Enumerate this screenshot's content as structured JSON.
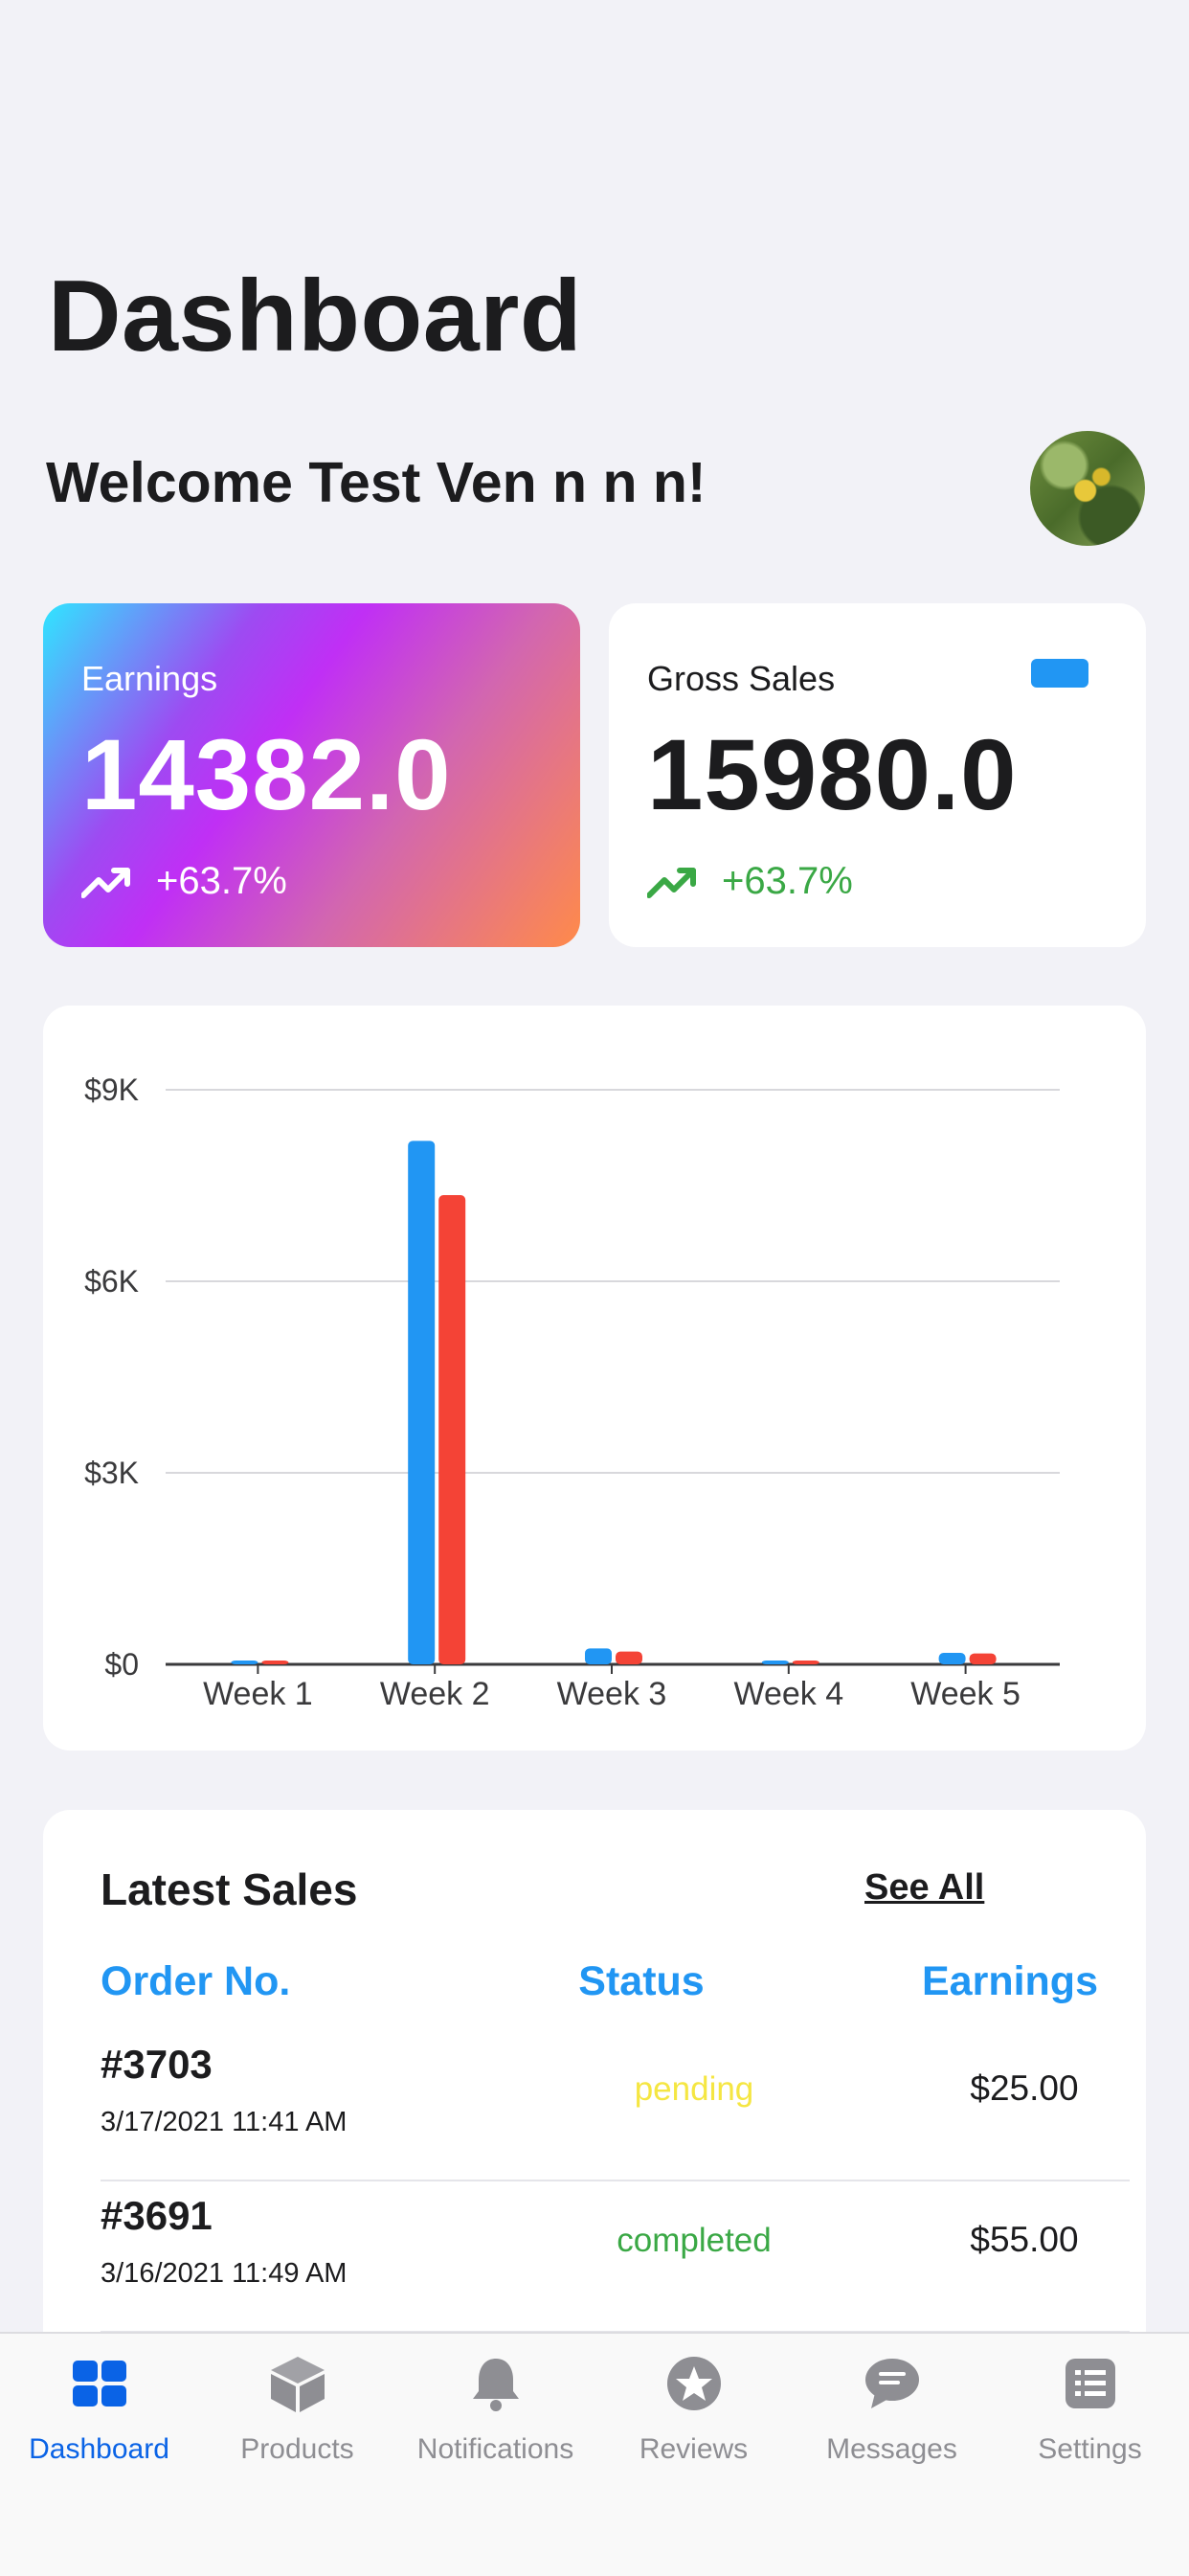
{
  "header": {
    "title": "Dashboard",
    "welcome": "Welcome Test Ven n n n!"
  },
  "earnings_card": {
    "label": "Earnings",
    "value": "14382.0",
    "trend": "+63.7%"
  },
  "gross_card": {
    "label": "Gross Sales",
    "value": "15980.0",
    "trend": "+63.7%"
  },
  "colors": {
    "series_blue": "#2196f3",
    "series_red": "#f44336",
    "accent": "#2196f3",
    "active_tab": "#0a63e6"
  },
  "chart_data": {
    "type": "bar",
    "categories": [
      "Week 1",
      "Week 2",
      "Week 3",
      "Week 4",
      "Week 5"
    ],
    "series": [
      {
        "values": [
          20,
          8200,
          250,
          20,
          180
        ]
      },
      {
        "values": [
          20,
          7350,
          200,
          20,
          170
        ]
      }
    ],
    "yticks": [
      "$0",
      "$3K",
      "$6K",
      "$9K"
    ],
    "ylim": [
      0,
      9000
    ],
    "grid": true
  },
  "latest_sales": {
    "title": "Latest Sales",
    "see_all": "See All",
    "columns": [
      "Order No.",
      "Status",
      "Earnings"
    ],
    "rows": [
      {
        "order": "#3703",
        "date": "3/17/2021 11:41 AM",
        "status": "pending",
        "earnings": "$25.00",
        "status_color": "#f5e642"
      },
      {
        "order": "#3691",
        "date": "3/16/2021 11:49 AM",
        "status": "completed",
        "earnings": "$55.00",
        "status_color": "#3aa845"
      }
    ]
  },
  "tabs": [
    {
      "label": "Dashboard",
      "icon": "dashboard-icon"
    },
    {
      "label": "Products",
      "icon": "box-icon"
    },
    {
      "label": "Notifications",
      "icon": "bell-icon"
    },
    {
      "label": "Reviews",
      "icon": "star-icon"
    },
    {
      "label": "Messages",
      "icon": "chat-icon"
    },
    {
      "label": "Settings",
      "icon": "list-icon"
    }
  ]
}
